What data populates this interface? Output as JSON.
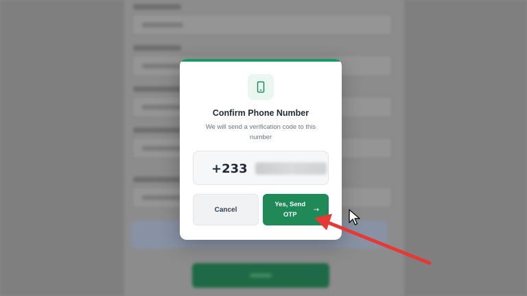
{
  "modal": {
    "title": "Confirm Phone Number",
    "subtitle": "We will send a verification code to this number",
    "phone_code": "+233",
    "icon": "smartphone-icon",
    "cancel_label": "Cancel",
    "confirm_label": "Yes, Send OTP",
    "confirm_icon": "arrow-right-icon"
  },
  "colors": {
    "accent": "#1d8a57",
    "accent_light": "#eaf7f0",
    "annotation_arrow": "#e53935"
  }
}
